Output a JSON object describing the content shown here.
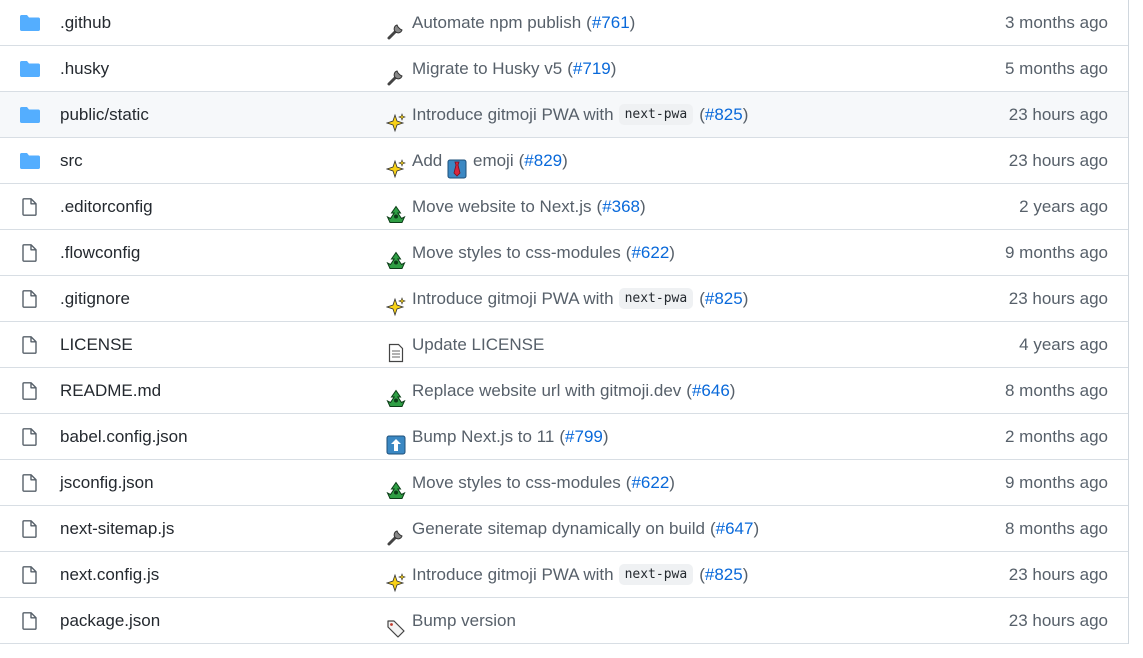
{
  "files": [
    {
      "name": ".github",
      "type": "folder",
      "emoji": "wrench-icon",
      "message": "Automate npm publish",
      "code": "",
      "pr": "#761",
      "age": "3 months ago"
    },
    {
      "name": ".husky",
      "type": "folder",
      "emoji": "wrench-icon",
      "message": "Migrate to Husky v5",
      "code": "",
      "pr": "#719",
      "age": "5 months ago"
    },
    {
      "name": "public/static",
      "type": "folder",
      "emoji": "sparkles-icon",
      "message": "Introduce gitmoji PWA with",
      "code": "next-pwa",
      "pr": "#825",
      "age": "23 hours ago"
    },
    {
      "name": "src",
      "type": "folder",
      "emoji": "sparkles-icon",
      "message": "Add",
      "code": "",
      "inline_emoji": "necktie-emoji",
      "message_after": "emoji",
      "pr": "#829",
      "age": "23 hours ago"
    },
    {
      "name": ".editorconfig",
      "type": "file",
      "emoji": "recycle-icon",
      "message": "Move website to Next.js",
      "code": "",
      "pr": "#368",
      "age": "2 years ago"
    },
    {
      "name": ".flowconfig",
      "type": "file",
      "emoji": "recycle-icon",
      "message": "Move styles to css-modules",
      "code": "",
      "pr": "#622",
      "age": "9 months ago"
    },
    {
      "name": ".gitignore",
      "type": "file",
      "emoji": "sparkles-icon",
      "message": "Introduce gitmoji PWA with",
      "code": "next-pwa",
      "pr": "#825",
      "age": "23 hours ago"
    },
    {
      "name": "LICENSE",
      "type": "file",
      "emoji": "page-icon",
      "message": "Update LICENSE",
      "code": "",
      "pr": "",
      "age": "4 years ago"
    },
    {
      "name": "README.md",
      "type": "file",
      "emoji": "recycle-icon",
      "message": "Replace website url with gitmoji.dev",
      "code": "",
      "pr": "#646",
      "age": "8 months ago"
    },
    {
      "name": "babel.config.json",
      "type": "file",
      "emoji": "arrow-up-icon",
      "message": "Bump Next.js to 11",
      "code": "",
      "pr": "#799",
      "age": "2 months ago"
    },
    {
      "name": "jsconfig.json",
      "type": "file",
      "emoji": "recycle-icon",
      "message": "Move styles to css-modules",
      "code": "",
      "pr": "#622",
      "age": "9 months ago"
    },
    {
      "name": "next-sitemap.js",
      "type": "file",
      "emoji": "wrench-icon",
      "message": "Generate sitemap dynamically on build",
      "code": "",
      "pr": "#647",
      "age": "8 months ago"
    },
    {
      "name": "next.config.js",
      "type": "file",
      "emoji": "sparkles-icon",
      "message": "Introduce gitmoji PWA with",
      "code": "next-pwa",
      "pr": "#825",
      "age": "23 hours ago"
    },
    {
      "name": "package.json",
      "type": "file",
      "emoji": "bookmark-icon",
      "message": "Bump version",
      "code": "",
      "pr": "",
      "age": "23 hours ago"
    }
  ],
  "colors": {
    "folder": "#54aeff",
    "file": "#57606a",
    "link": "#0969da",
    "text": "#24292f",
    "muted": "#57606a"
  }
}
